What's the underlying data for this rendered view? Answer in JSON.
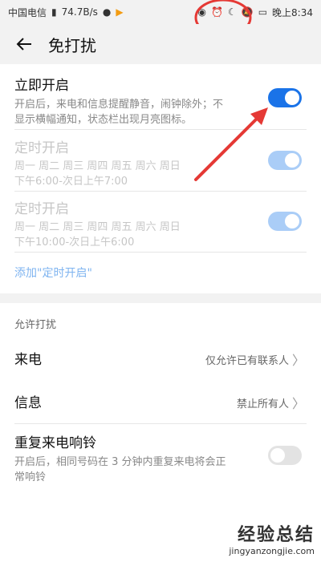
{
  "status": {
    "carrier": "中国电信",
    "net_speed": "74.7B/s",
    "time": "晚上8:34"
  },
  "header": {
    "title": "免打扰"
  },
  "top": {
    "immediate": {
      "title": "立即开启",
      "sub1": "开启后，来电和信息提醒静音，闹钟除外；不",
      "sub2": "显示横幅通知，状态栏出现月亮图标。"
    },
    "schedule1": {
      "title": "定时开启",
      "days": "周一 周二 周三 周四 周五 周六 周日",
      "time": "下午6:00-次日上午7:00"
    },
    "schedule2": {
      "title": "定时开启",
      "days": "周一 周二 周三 周四 周五 周六 周日",
      "time": "下午10:00-次日上午6:00"
    },
    "add_schedule": "添加\"定时开启\""
  },
  "allow": {
    "section_label": "允许打扰",
    "calls": {
      "title": "来电",
      "value": "仅允许已有联系人"
    },
    "messages": {
      "title": "信息",
      "value": "禁止所有人"
    },
    "repeat": {
      "title": "重复来电响铃",
      "sub1": "开启后，相同号码在 3 分钟内重复来电将会正",
      "sub2": "常响铃"
    }
  },
  "watermark": {
    "top": "经验总结",
    "bottom": "jingyanzongjie.com"
  },
  "colors": {
    "accent": "#1a73e8",
    "annotation": "#e53935"
  }
}
